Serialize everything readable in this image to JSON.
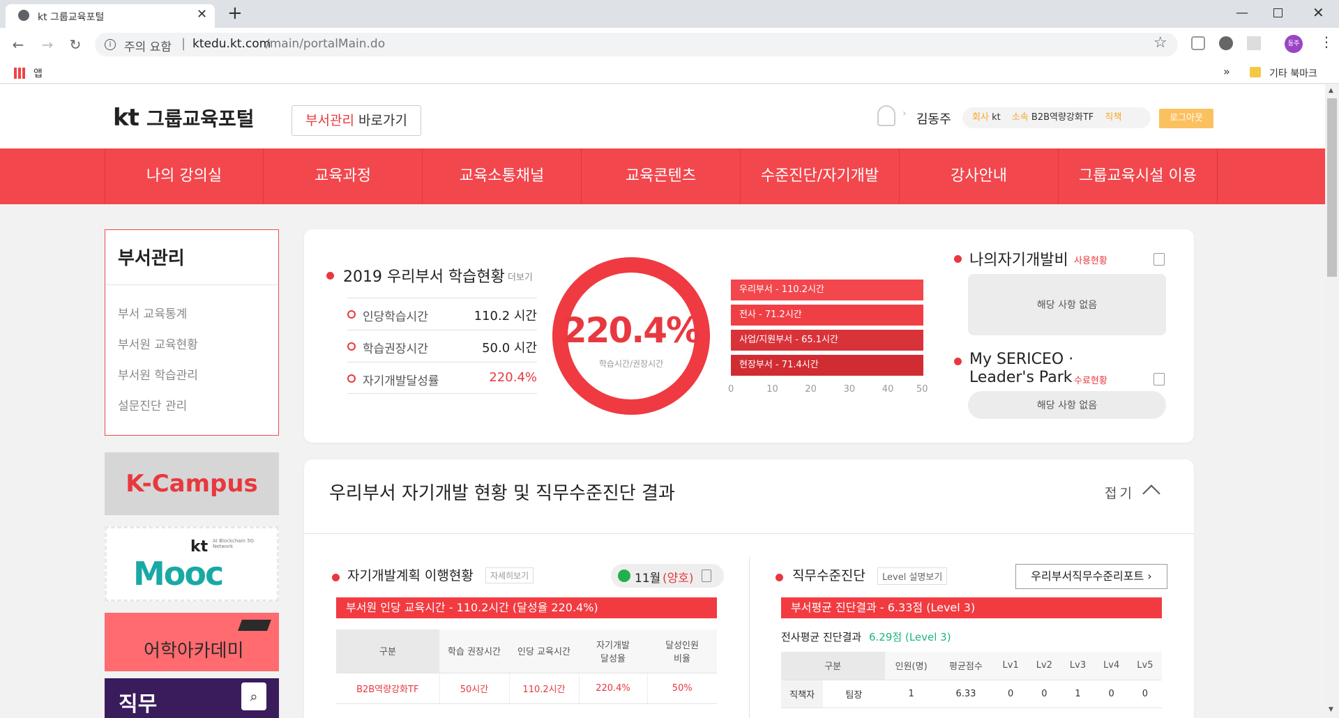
{
  "browser": {
    "tab_title": "kt 그룹교육포털",
    "new_tab": "+",
    "security_label": "주의 요함",
    "url_host": "ktedu.kt.com",
    "url_path": "/main/portalMain.do",
    "apps_label": "앱",
    "bookmarks_more": "»",
    "other_bookmarks": "기타 북마크",
    "profile_initials": "동주"
  },
  "header": {
    "logo_kt": "kt",
    "logo_text": "그룹교육포털",
    "dept_btn_red": "부서관리",
    "dept_btn_rest": "바로가기",
    "user_name": "김동주",
    "company_label": "회사",
    "company_value": "kt",
    "org_label": "소속",
    "org_value": "B2B역량강화TF",
    "title_label": "직책",
    "logout": "로그아웃"
  },
  "gnb": [
    "나의 강의실",
    "교육과정",
    "교육소통채널",
    "교육콘텐츠",
    "수준진단/자기개발",
    "강사안내",
    "그룹교육시설 이용"
  ],
  "sidebar": {
    "title": "부서관리",
    "items": [
      "부서 교육통계",
      "부서원 교육현황",
      "부서원 학습관리",
      "설문진단 관리"
    ],
    "banners": {
      "kcampus": "K-Campus",
      "mooc_kt": "kt",
      "mooc_sub": "AI Blockchain 5G Network",
      "mooc_word": "Mooc",
      "language": "어학아카데미",
      "job": "직무"
    }
  },
  "study": {
    "title": "2019 우리부서 학습현황",
    "more": "더보기",
    "rows": [
      {
        "label": "인당학습시간",
        "value": "110.2 시간"
      },
      {
        "label": "학습권장시간",
        "value": "50.0 시간"
      },
      {
        "label": "자기개발달성률",
        "value": "220.4%"
      }
    ],
    "donut_value": "220.4%",
    "donut_caption": "학습시간/권장시간",
    "donut_fill": 1.0
  },
  "chart_data": {
    "type": "bar",
    "orientation": "horizontal",
    "categories": [
      "우리부서",
      "전사",
      "사업/지원부서",
      "현장부서"
    ],
    "labels": [
      "우리부서 - 110.2시간",
      "전사 - 71.2시간",
      "사업/지원부서 - 65.1시간",
      "현장부서 - 71.4시간"
    ],
    "values": [
      110.2,
      71.2,
      65.1,
      71.4
    ],
    "xlim": [
      0,
      50
    ],
    "ticks": [
      "0",
      "10",
      "20",
      "30",
      "40",
      "50"
    ],
    "colors": [
      "#f2474d",
      "#ef3f45",
      "#d9333a",
      "#d22c33"
    ]
  },
  "selfdev": {
    "title": "나의자기개발비",
    "link": "사용현황",
    "empty": "해당 사항 없음",
    "sericeo_title1": "My SERICEO ·",
    "sericeo_title2": "Leader's Park",
    "sericeo_link": "수료현황",
    "sericeo_empty": "해당 사항 없음"
  },
  "section": {
    "title": "우리부서 자기개발 현황 및 직무수준진단 결과",
    "toggle": "접기"
  },
  "plan": {
    "title": "자기개발계획 이행현황",
    "detail_btn": "자세히보기",
    "month": "11월",
    "status": "(양호)",
    "banner": "부서원 인당 교육시간 - 110.2시간 (달성율 220.4%)",
    "headers": [
      "구분",
      "학습 권장시간",
      "인당 교육시간",
      "자기개발\n달성율",
      "달성인원\n비율"
    ],
    "row": [
      "B2B역량강화TF",
      "50시간",
      "110.2시간",
      "220.4%",
      "50%"
    ]
  },
  "diag": {
    "title": "직무수준진단",
    "level_btn": "Level 설명보기",
    "report_btn": "우리부서직무수준리포트",
    "banner": "부서평균 진단결과 - 6.33점 (Level 3)",
    "company_avg_label": "전사평균 진단결과",
    "company_avg_value": "6.29점 (Level 3)",
    "headers": [
      "구분",
      "인원(명)",
      "평균점수",
      "Lv1",
      "Lv2",
      "Lv3",
      "Lv4",
      "Lv5"
    ],
    "row": [
      "직책자",
      "팀장",
      "1",
      "6.33",
      "0",
      "0",
      "1",
      "0",
      "0"
    ]
  },
  "colors": {
    "brand": "#f2474d",
    "accent_green": "#1db67a"
  }
}
